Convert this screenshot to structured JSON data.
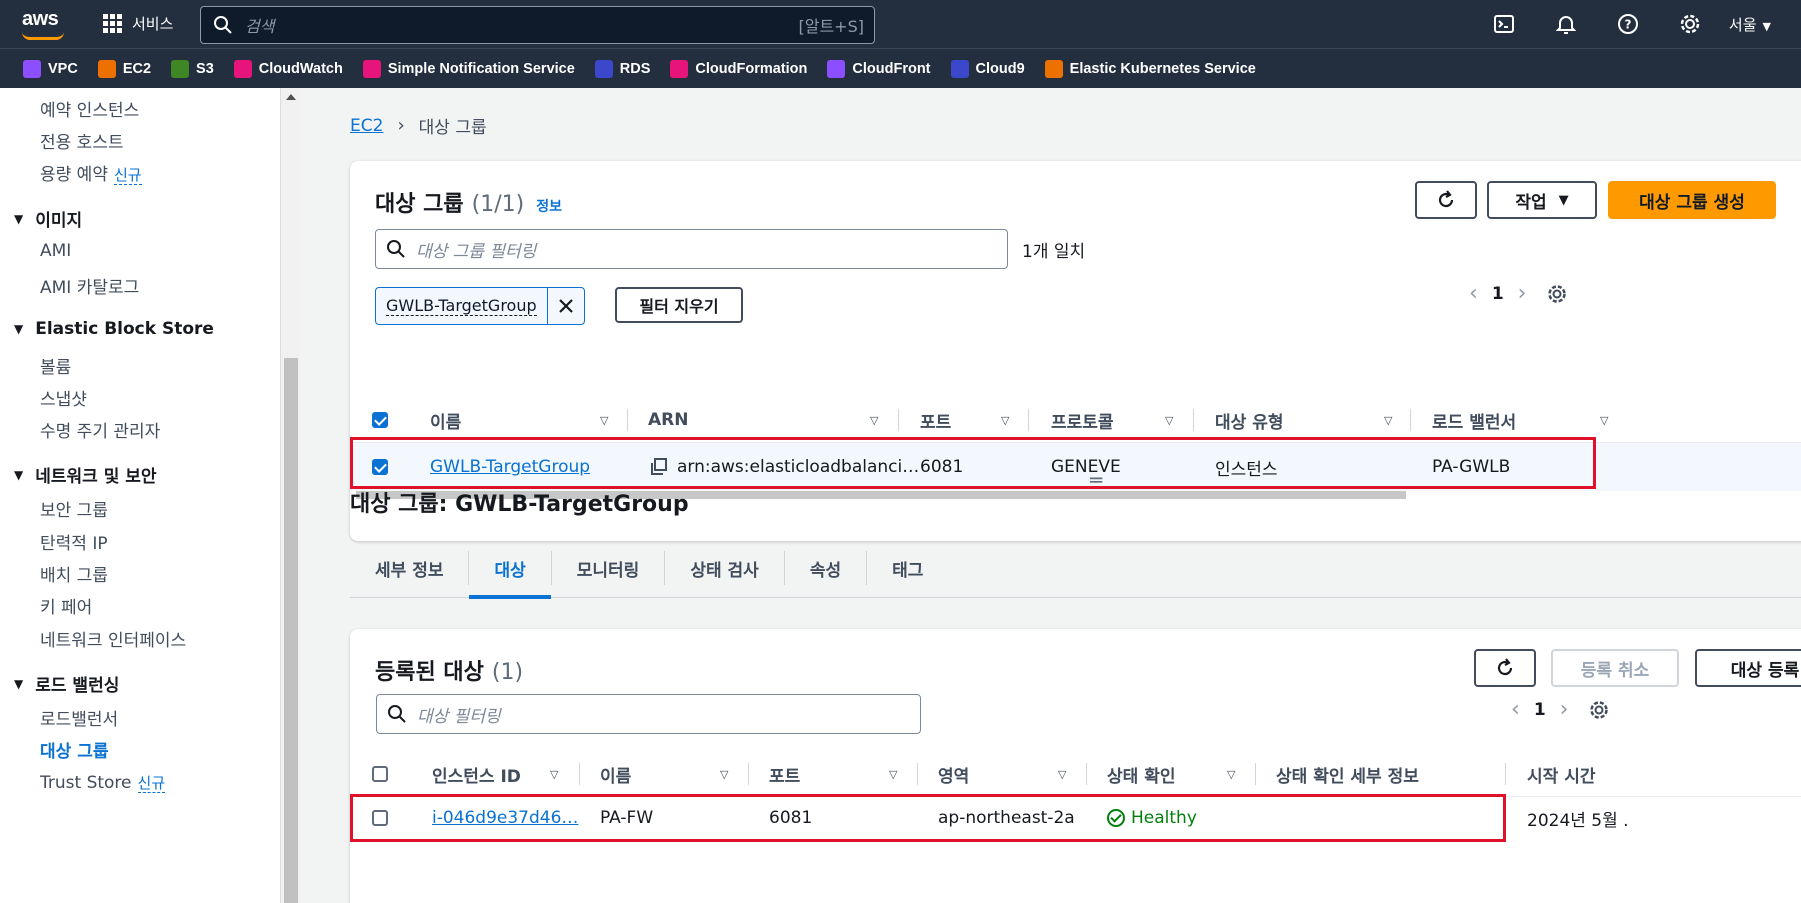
{
  "topbar": {
    "logo": "aws",
    "services_label": "서비스",
    "search_placeholder": "검색",
    "search_shortcut": "[알트+S]",
    "region": "서울",
    "icons": [
      "cloudshell-icon",
      "notifications-icon",
      "help-icon",
      "settings-icon"
    ]
  },
  "favorites": [
    {
      "label": "VPC",
      "color": "#8c4fff"
    },
    {
      "label": "EC2",
      "color": "#ed7100"
    },
    {
      "label": "S3",
      "color": "#3f8624"
    },
    {
      "label": "CloudWatch",
      "color": "#e7157b"
    },
    {
      "label": "Simple Notification Service",
      "color": "#e7157b"
    },
    {
      "label": "RDS",
      "color": "#3b48cc"
    },
    {
      "label": "CloudFormation",
      "color": "#e7157b"
    },
    {
      "label": "CloudFront",
      "color": "#8c4fff"
    },
    {
      "label": "Cloud9",
      "color": "#3b48cc"
    },
    {
      "label": "Elastic Kubernetes Service",
      "color": "#ed7100"
    }
  ],
  "sidebar": {
    "items_top": [
      "예약 인스턴스",
      "전용 호스트",
      "용량 예약"
    ],
    "new_badge": "신규",
    "sections": [
      {
        "title": "이미지",
        "items": [
          "AMI",
          "AMI 카탈로그"
        ]
      },
      {
        "title": "Elastic Block Store",
        "items": [
          "볼륨",
          "스냅샷",
          "수명 주기 관리자"
        ]
      },
      {
        "title": "네트워크 및 보안",
        "items": [
          "보안 그룹",
          "탄력적 IP",
          "배치 그룹",
          "키 페어",
          "네트워크 인터페이스"
        ]
      },
      {
        "title": "로드 밸런싱",
        "items": [
          "로드밸런서",
          "대상 그룹",
          "Trust Store"
        ]
      }
    ]
  },
  "breadcrumb": {
    "root": "EC2",
    "current": "대상 그룹"
  },
  "target_groups": {
    "title": "대상 그룹",
    "count": "(1/1)",
    "info": "정보",
    "actions_label": "작업",
    "create_label": "대상 그룹 생성",
    "filter_placeholder": "대상 그룹 필터링",
    "match_text": "1개 일치",
    "token": "GWLB-TargetGroup",
    "clear_filters": "필터 지우기",
    "page": "1",
    "columns": [
      "이름",
      "ARN",
      "포트",
      "프로토콜",
      "대상 유형",
      "로드 밸런서"
    ],
    "row": {
      "name": "GWLB-TargetGroup",
      "arn": "arn:aws:elasticloadbalanci…",
      "port": "6081",
      "protocol": "GENEVE",
      "target_type": "인스턴스",
      "load_balancer": "PA-GWLB",
      "selected": true
    }
  },
  "detail": {
    "title": "대상 그룹: GWLB-TargetGroup",
    "tabs": [
      "세부 정보",
      "대상",
      "모니터링",
      "상태 검사",
      "속성",
      "태그"
    ],
    "active_tab": "대상"
  },
  "registered": {
    "title": "등록된 대상",
    "count": "(1)",
    "deregister_label": "등록 취소",
    "register_label": "대상 등록",
    "filter_placeholder": "대상 필터링",
    "page": "1",
    "columns": [
      "인스턴스 ID",
      "이름",
      "포트",
      "영역",
      "상태 확인",
      "상태 확인 세부 정보",
      "시작 시간"
    ],
    "row": {
      "instance_id": "i-046d9e37d46…",
      "name": "PA-FW",
      "port": "6081",
      "zone": "ap-northeast-2a",
      "health": "Healthy",
      "health_details": "",
      "launch_time": "2024년 5월 ."
    }
  },
  "colors": {
    "accent": "#0972d3",
    "primary_button": "#ff9900",
    "highlight": "#e0112b",
    "healthy": "#037f0c",
    "nav_bg": "#232f3e"
  }
}
